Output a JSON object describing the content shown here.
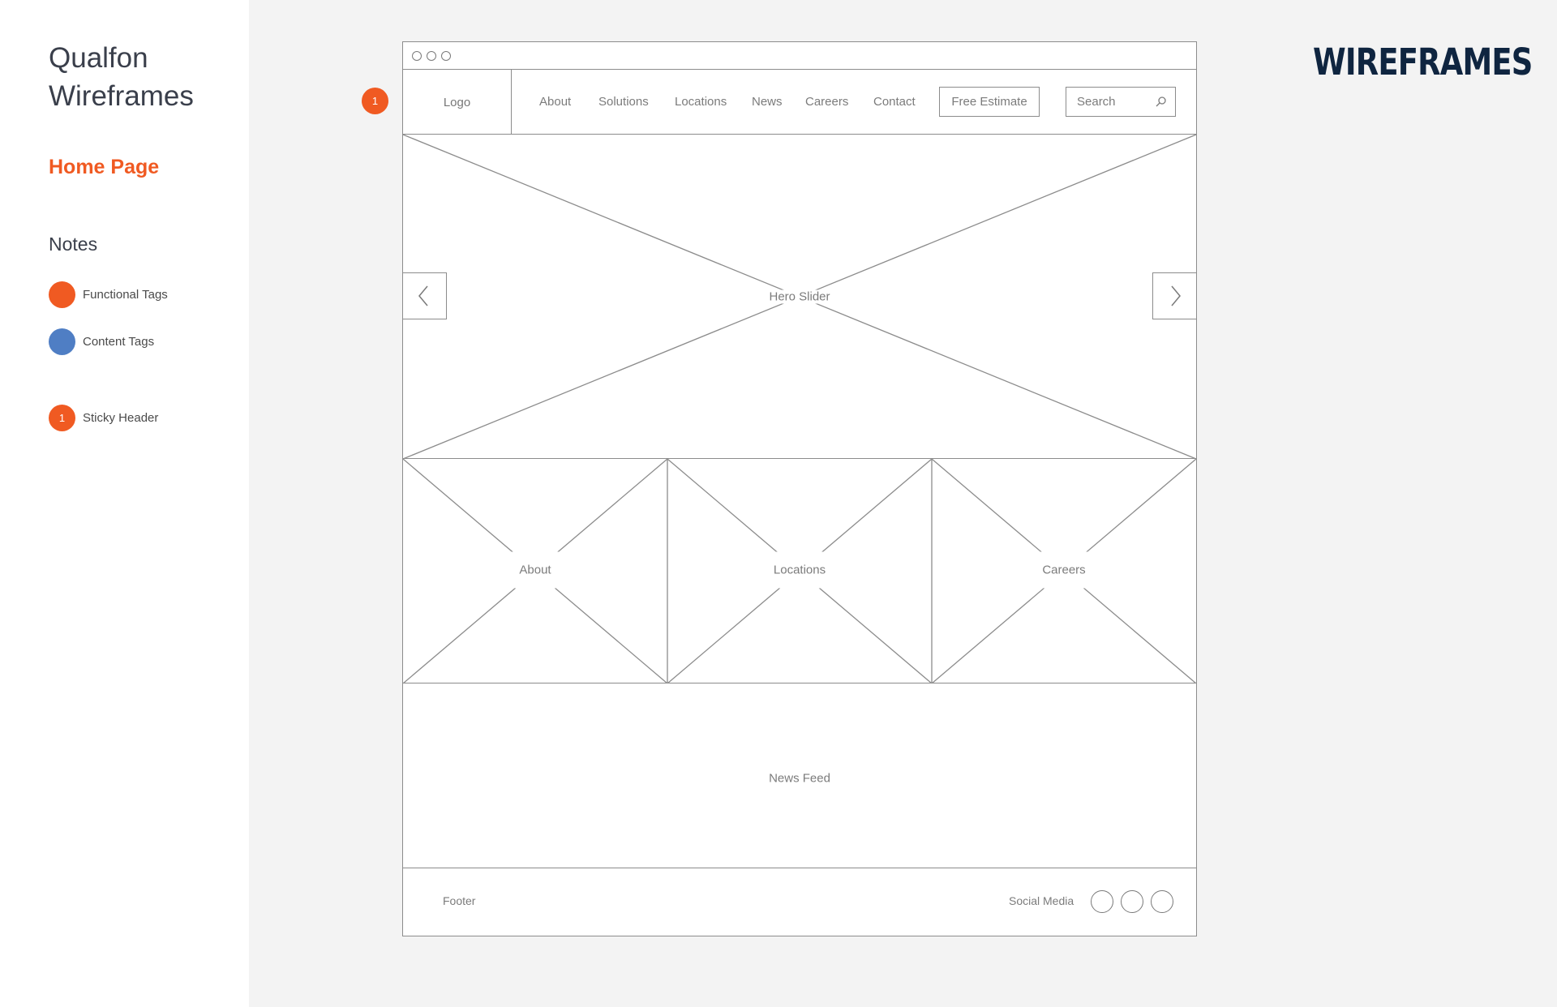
{
  "sidebar": {
    "title_line1": "Qualfon",
    "title_line2": "Wireframes",
    "current_page": "Home Page",
    "notes_heading": "Notes",
    "legend": [
      {
        "label": "Functional Tags",
        "color": "#f05a22"
      },
      {
        "label": "Content Tags",
        "color": "#4f7ec4"
      }
    ],
    "tag_notes": [
      {
        "number": "1",
        "label": "Sticky Header",
        "color": "#f05a22"
      }
    ]
  },
  "brand": "WIREFRAMES",
  "wireframe": {
    "tag_marker": "1",
    "header": {
      "logo": "Logo",
      "nav": [
        "About",
        "Solutions",
        "Locations",
        "News",
        "Careers",
        "Contact"
      ],
      "cta": "Free Estimate",
      "search_placeholder": "Search",
      "search_icon": "search-icon"
    },
    "hero": {
      "label": "Hero Slider",
      "prev_icon": "chevron-left-icon",
      "next_icon": "chevron-right-icon"
    },
    "tiles": [
      "About",
      "Locations",
      "Careers"
    ],
    "news": "News Feed",
    "footer": {
      "label": "Footer",
      "social_label": "Social Media",
      "social_count": 3
    }
  }
}
